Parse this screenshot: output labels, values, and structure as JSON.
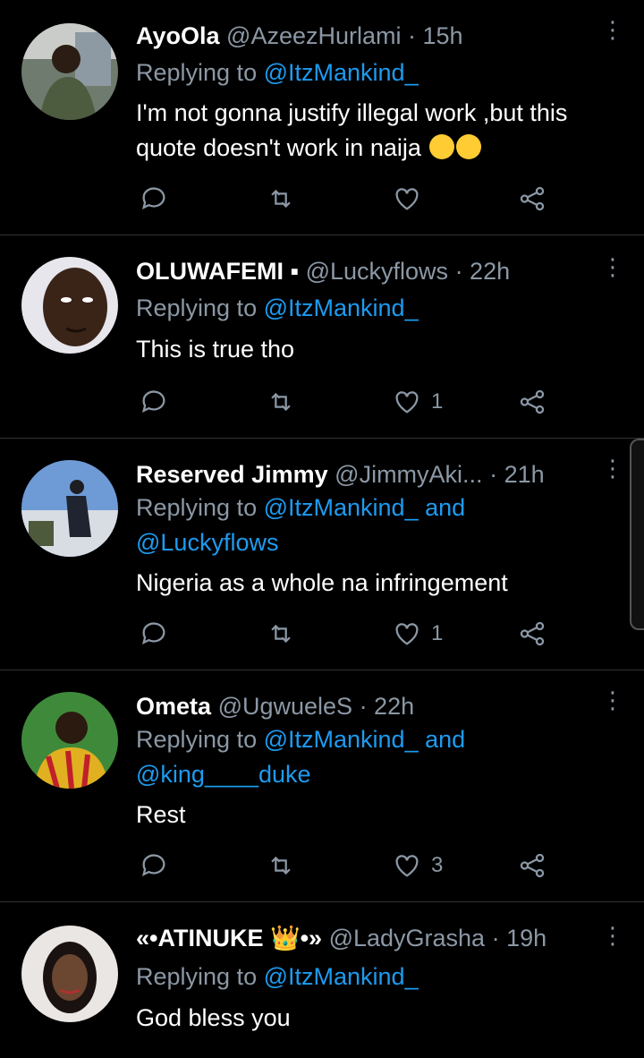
{
  "tweets": [
    {
      "name": "AyoOla",
      "handle": "@AzeezHurlami",
      "time": "· 15h",
      "reply_prefix": "Replying to",
      "reply_line1": "@ItzMankind_",
      "reply_line2": "",
      "text_line1": "I'm not gonna justify illegal work ,but this",
      "text_line2": "quote doesn't work in naija",
      "like_count": ""
    },
    {
      "name": "OLUWAFEMI ▪",
      "handle": "@Luckyflows",
      "time": "· 22h",
      "reply_prefix": "Replying to",
      "reply_line1": "@ItzMankind_",
      "reply_line2": "",
      "text_line1": "This is true tho",
      "text_line2": "",
      "like_count": "1"
    },
    {
      "name": "Reserved Jimmy",
      "handle": "@JimmyAki...",
      "time": "· 21h",
      "reply_prefix": "Replying to",
      "reply_line1": "@ItzMankind_ and",
      "reply_line2": "@Luckyflows",
      "text_line1": "Nigeria as a whole na infringement",
      "text_line2": "",
      "like_count": "1"
    },
    {
      "name": "Ometa",
      "handle": "@UgwueleS",
      "time": "· 22h",
      "reply_prefix": "Replying to",
      "reply_line1": "@ItzMankind_ and",
      "reply_line2": "@king____duke",
      "text_line1": "Rest",
      "text_line2": "",
      "like_count": "3"
    },
    {
      "name": "«•ATINUKE 👑•»",
      "handle": "@LadyGrasha",
      "time": "· 19h",
      "reply_prefix": "Replying to",
      "reply_line1": "@ItzMankind_",
      "reply_line2": "",
      "text_line1": "God bless you",
      "text_line2": "",
      "like_count": ""
    }
  ],
  "icons": [
    "reply-icon",
    "retweet-icon",
    "like-icon",
    "share-icon",
    "more-icon"
  ],
  "colors": {
    "background": "#000000",
    "link": "#1d9bf0",
    "muted": "#8b98a5",
    "divider": "#2f3336"
  }
}
